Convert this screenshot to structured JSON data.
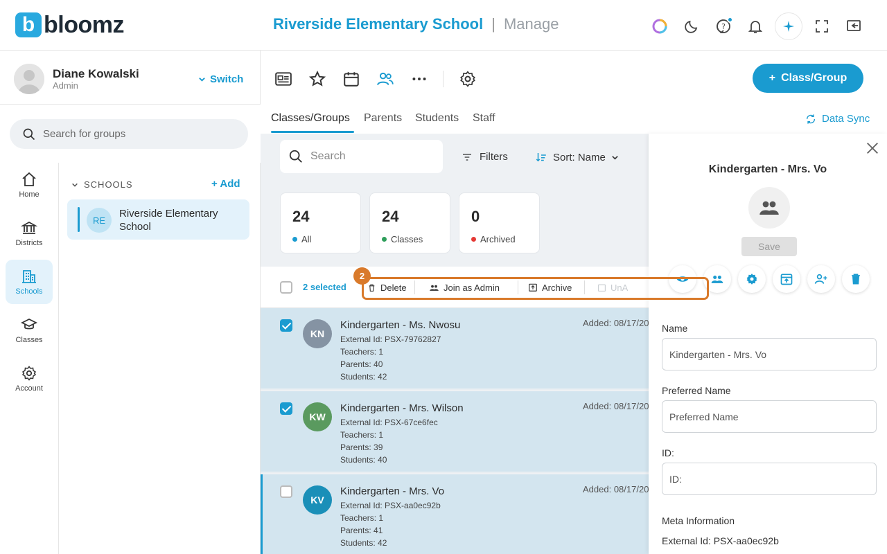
{
  "header": {
    "logo_letter": "b",
    "logo_text": "bloomz",
    "school_name": "Riverside Elementary School",
    "separator": "|",
    "section": "Manage"
  },
  "user": {
    "name": "Diane Kowalski",
    "role": "Admin",
    "switch_label": "Switch"
  },
  "left_search": {
    "placeholder": "Search for groups"
  },
  "nav": [
    {
      "label": "Home",
      "icon": "home-icon"
    },
    {
      "label": "Districts",
      "icon": "districts-icon"
    },
    {
      "label": "Schools",
      "icon": "schools-icon"
    },
    {
      "label": "Classes",
      "icon": "classes-icon"
    },
    {
      "label": "Account",
      "icon": "gear-icon"
    }
  ],
  "schools": {
    "header": "SCHOOLS",
    "add_label": "Add",
    "items": [
      {
        "initials": "RE",
        "name": "Riverside Elementary School"
      }
    ]
  },
  "toolbar": {
    "add_button_label": "Class/Group"
  },
  "tabs": [
    "Classes/Groups",
    "Parents",
    "Students",
    "Staff"
  ],
  "data_sync_label": "Data Sync",
  "list": {
    "search_placeholder": "Search",
    "filters_label": "Filters",
    "sort_label": "Sort: Name",
    "stats": [
      {
        "count": "24",
        "label": "All",
        "color": "#1a9bd0"
      },
      {
        "count": "24",
        "label": "Classes",
        "color": "#2e9e5b"
      },
      {
        "count": "0",
        "label": "Archived",
        "color": "#e53935"
      }
    ],
    "selected_text": "2 selected",
    "actions": [
      "Delete",
      "Join as Admin",
      "Archive",
      "UnA"
    ],
    "rows": [
      {
        "initials": "KN",
        "title": "Kindergarten - Ms. Nwosu",
        "external_id": "External Id: PSX-79762827",
        "teachers": "Teachers: 1",
        "parents": "Parents: 40",
        "students": "Students: 42",
        "added": "Added: 08/17/20",
        "avatar_color": "#8593a3",
        "checked": true
      },
      {
        "initials": "KW",
        "title": "Kindergarten - Mrs. Wilson",
        "external_id": "External Id: PSX-67ce6fec",
        "teachers": "Teachers: 1",
        "parents": "Parents: 39",
        "students": "Students: 40",
        "added": "Added: 08/17/20",
        "avatar_color": "#5a9a5f",
        "checked": true
      },
      {
        "initials": "KV",
        "title": "Kindergarten - Mrs. Vo",
        "external_id": "External Id: PSX-aa0ec92b",
        "teachers": "Teachers: 1",
        "parents": "Parents: 41",
        "students": "Students: 42",
        "added": "Added: 08/17/20",
        "avatar_color": "#1a8fb8",
        "checked": false
      }
    ]
  },
  "panel": {
    "title": "Kindergarten - Mrs. Vo",
    "save_label": "Save",
    "name_label": "Name",
    "name_value": "Kindergarten - Mrs. Vo",
    "preferred_label": "Preferred Name",
    "preferred_placeholder": "Preferred Name",
    "id_label": "ID:",
    "id_placeholder": "ID:",
    "meta_label": "Meta Information",
    "meta_external_id": "External Id: PSX-aa0ec92b"
  },
  "overlay": {
    "step_number": "2"
  },
  "colors": {
    "accent": "#1a9bd0",
    "highlight": "#d97a2b"
  }
}
